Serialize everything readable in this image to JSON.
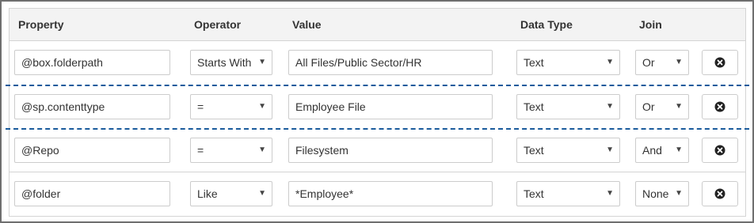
{
  "headers": {
    "property": "Property",
    "operator": "Operator",
    "value": "Value",
    "data_type": "Data Type",
    "join": "Join"
  },
  "rows": [
    {
      "property": "@box.folderpath",
      "operator": "Starts With",
      "value": "All Files/Public Sector/HR",
      "data_type": "Text",
      "join": "Or"
    },
    {
      "property": "@sp.contenttype",
      "operator": "=",
      "value": "Employee File",
      "data_type": "Text",
      "join": "Or"
    },
    {
      "property": "@Repo",
      "operator": "=",
      "value": "Filesystem",
      "data_type": "Text",
      "join": "And"
    },
    {
      "property": "@folder",
      "operator": "Like",
      "value": "*Employee*",
      "data_type": "Text",
      "join": "None"
    }
  ],
  "icons": {
    "dropdown": "caret-down-icon",
    "delete": "close-circle-icon"
  },
  "colors": {
    "group_separator": "#1a5b9c",
    "header_bg": "#f3f3f3",
    "border": "#cccccc"
  }
}
